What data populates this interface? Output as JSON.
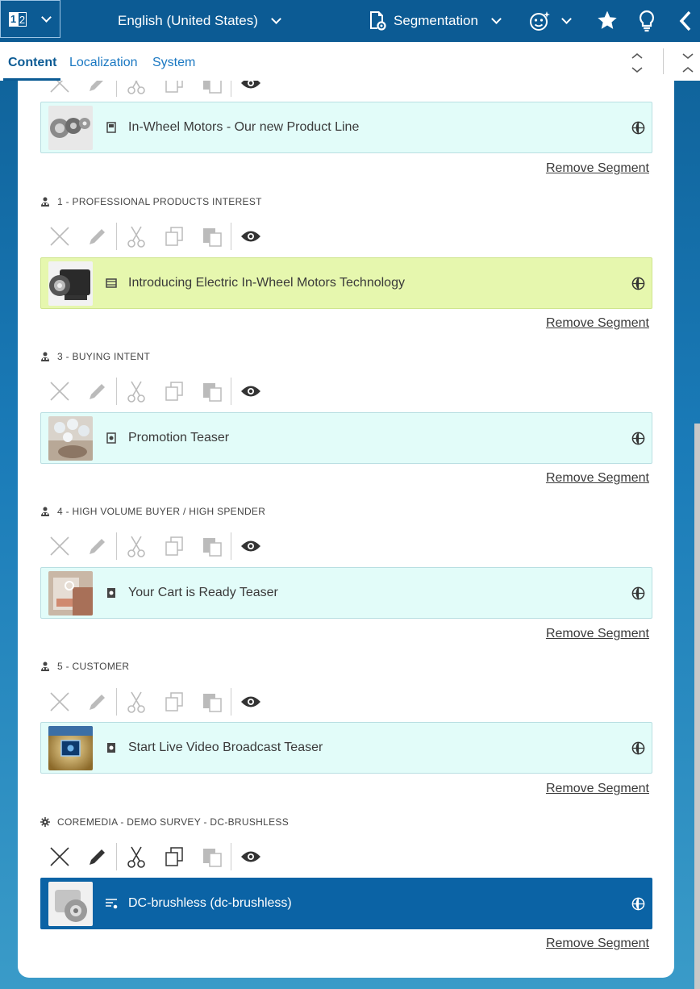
{
  "topbar": {
    "format_numbers": [
      "1",
      "2"
    ],
    "language": "English (United States)",
    "segmentation": "Segmentation"
  },
  "tabs": [
    "Content",
    "Localization",
    "System"
  ],
  "remove_label": "Remove Segment",
  "first_item": {
    "title": "In-Wheel Motors - Our new Product Line"
  },
  "segments": [
    {
      "label": "1 - PROFESSIONAL PRODUCTS INTEREST",
      "item": "Introducing Electric In-Wheel Motors Technology"
    },
    {
      "label": "3 - BUYING INTENT",
      "item": "Promotion Teaser"
    },
    {
      "label": "4 - HIGH VOLUME BUYER / HIGH SPENDER",
      "item": "Your Cart is Ready Teaser"
    },
    {
      "label": "5 - CUSTOMER",
      "item": "Start Live Video Broadcast Teaser"
    },
    {
      "label": "COREMEDIA - DEMO SURVEY - DC-BRUSHLESS",
      "item": "DC-brushless (dc-brushless)"
    }
  ],
  "colors": {
    "brand": "#0c5b94",
    "selected": "#0b63a5",
    "card": "#e2fcf9",
    "card_highlight": "#e6f7ae"
  }
}
